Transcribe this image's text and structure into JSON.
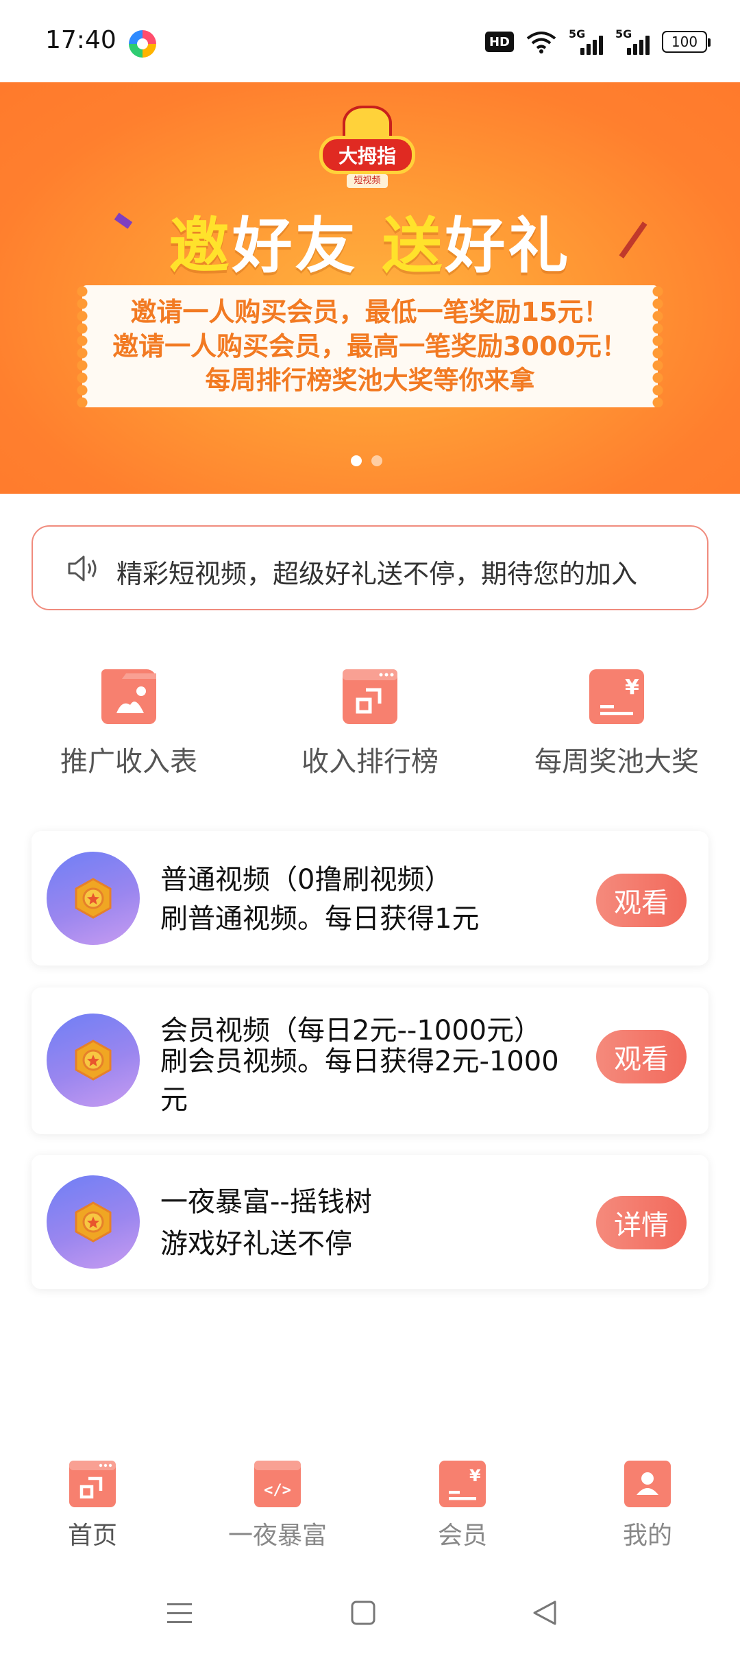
{
  "status_bar": {
    "time": "17:40",
    "hd_label": "HD",
    "network_1": "5G",
    "network_2": "5G",
    "battery": "100"
  },
  "banner": {
    "logo_text": "大拇指",
    "logo_subtext": "短视频",
    "headline_part1_highlight": "邀",
    "headline_part2": "好友 ",
    "headline_part3_highlight": "送",
    "headline_part4": "好礼",
    "ticket_lines": [
      "邀请一人购买会员，最低一笔奖励15元！",
      "邀请一人购买会员，最高一笔奖励3000元！",
      "每周排行榜奖池大奖等你来拿"
    ],
    "active_slide": 1,
    "slide_count": 2
  },
  "notice": {
    "icon": "speaker-icon",
    "text": "精彩短视频，超级好礼送不停，期待您的加入"
  },
  "quick_menu": [
    {
      "label": "推广收入表",
      "icon": "folder-image-icon"
    },
    {
      "label": "收入排行榜",
      "icon": "window-share-icon"
    },
    {
      "label": "每周奖池大奖",
      "icon": "yen-card-icon"
    }
  ],
  "tasks": [
    {
      "title": "普通视频（0撸刷视频）",
      "desc": "刷普通视频。每日获得1元",
      "button": "观看",
      "icon": "medal-icon"
    },
    {
      "title": "会员视频（每日2元--1000元）",
      "desc": "刷会员视频。每日获得2元-1000元",
      "button": "观看",
      "icon": "medal-icon"
    },
    {
      "title": "一夜暴富--摇钱树",
      "desc": "游戏好礼送不停",
      "button": "详情",
      "icon": "medal-icon"
    }
  ],
  "bottom_nav": [
    {
      "label": "首页",
      "icon": "home-window-icon",
      "active": true
    },
    {
      "label": "一夜暴富",
      "icon": "code-window-icon",
      "active": false
    },
    {
      "label": "会员",
      "icon": "yen-card-icon",
      "active": false
    },
    {
      "label": "我的",
      "icon": "user-icon",
      "active": false
    }
  ],
  "colors": {
    "accent": "#f7806f",
    "banner_orange": "#ff8a30",
    "ticket_text": "#f27a22",
    "headline_highlight": "#ffe22b"
  }
}
